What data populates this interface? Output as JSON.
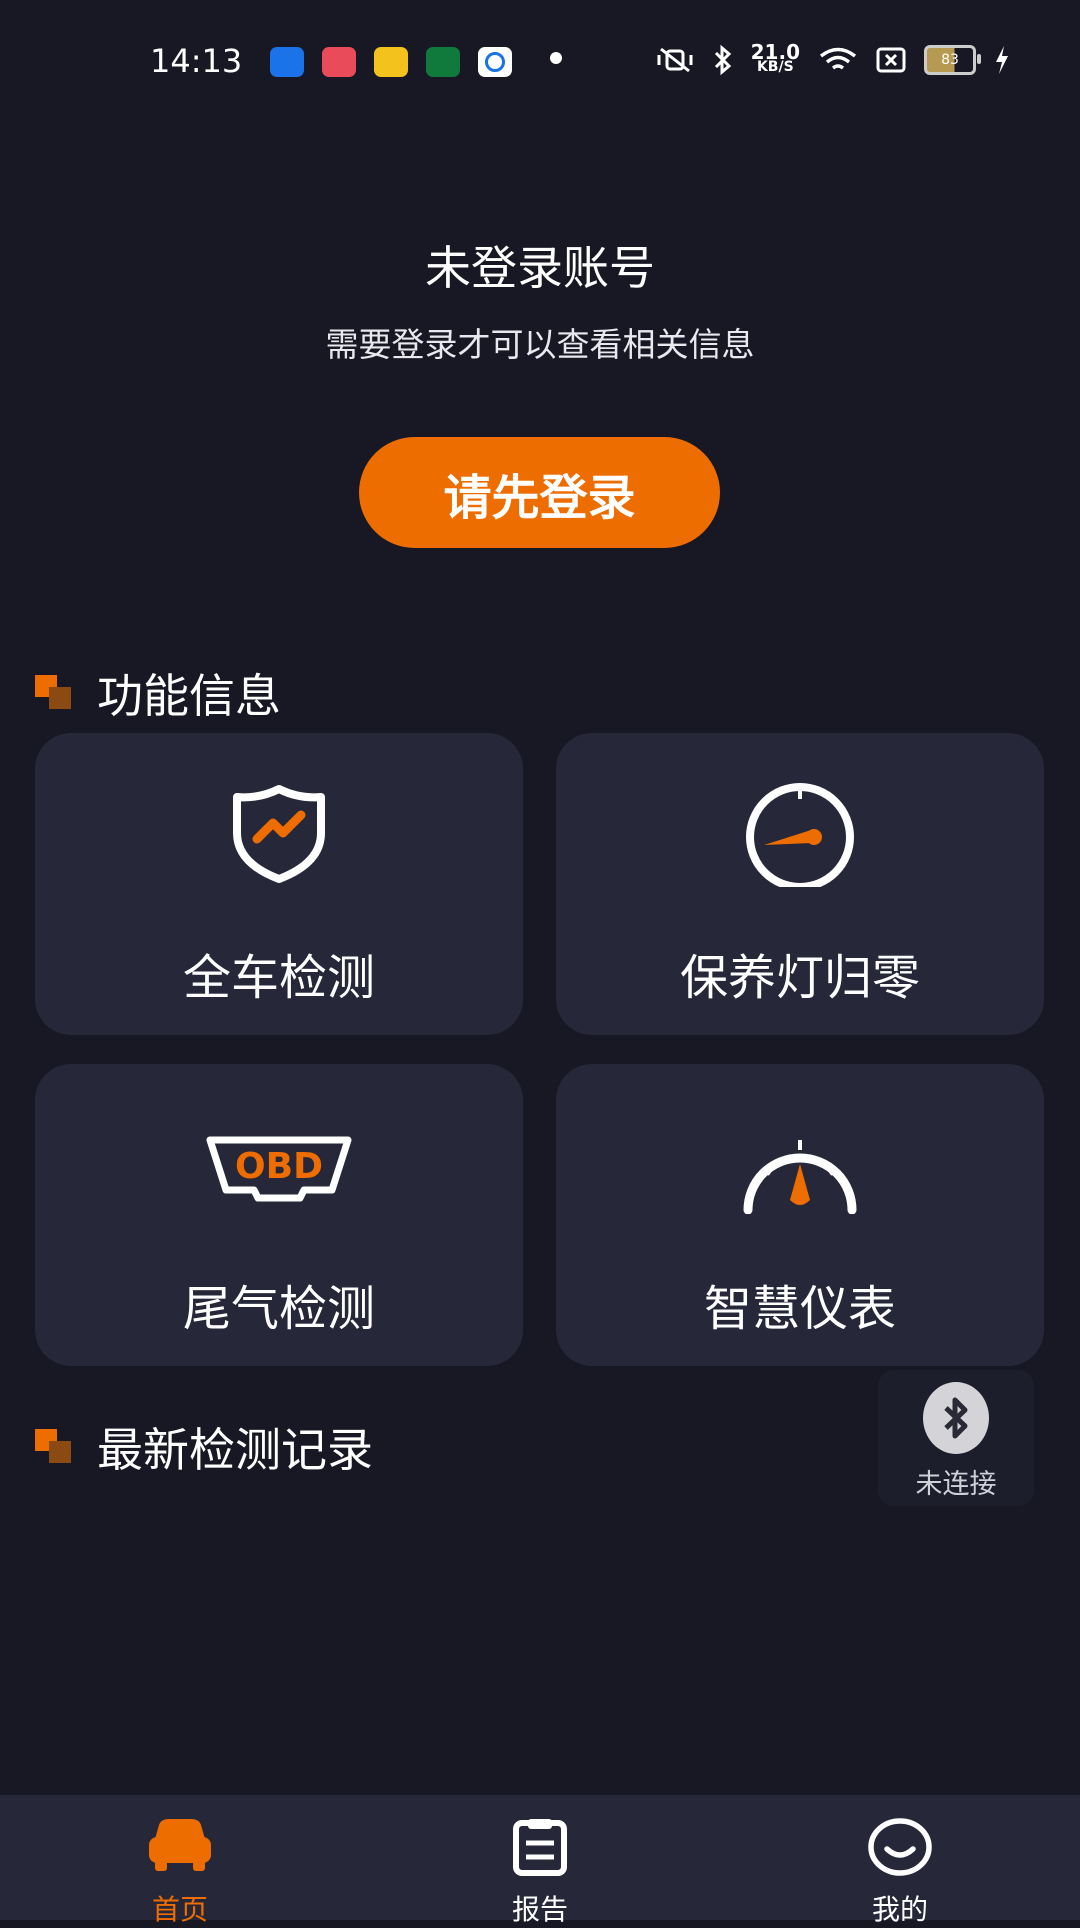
{
  "status_bar": {
    "time": "14:13",
    "net_speed_value": "21.0",
    "net_speed_unit": "KB/S",
    "battery": "83",
    "app_icons": [
      {
        "name": "blue-app-icon",
        "color": "#1a73e8"
      },
      {
        "name": "red-app-icon",
        "color": "#e94b5a"
      },
      {
        "name": "yellow-app-icon",
        "color": "#f4c21c"
      },
      {
        "name": "green-app-icon",
        "color": "#0f7a3c"
      },
      {
        "name": "white-app-icon",
        "color": "#ffffff"
      }
    ]
  },
  "login": {
    "title": "未登录账号",
    "subtitle": "需要登录才可以查看相关信息",
    "button_label": "请先登录"
  },
  "function_section": {
    "title": "功能信息",
    "cards": [
      {
        "label": "全车检测",
        "icon": "shield-icon"
      },
      {
        "label": "保养灯归零",
        "icon": "gauge-reset-icon"
      },
      {
        "label": "尾气检测",
        "icon": "obd-icon",
        "icon_text": "OBD"
      },
      {
        "label": "智慧仪表",
        "icon": "speedometer-icon"
      }
    ]
  },
  "records_section": {
    "title": "最新检测记录"
  },
  "bluetooth": {
    "status": "未连接",
    "icon": "bluetooth-icon"
  },
  "tabbar": {
    "tabs": [
      {
        "label": "首页",
        "icon": "car-icon",
        "active": true
      },
      {
        "label": "报告",
        "icon": "report-icon",
        "active": false
      },
      {
        "label": "我的",
        "icon": "profile-icon",
        "active": false
      }
    ]
  },
  "colors": {
    "accent": "#ee6d00",
    "background": "#181824",
    "card": "#262839"
  }
}
